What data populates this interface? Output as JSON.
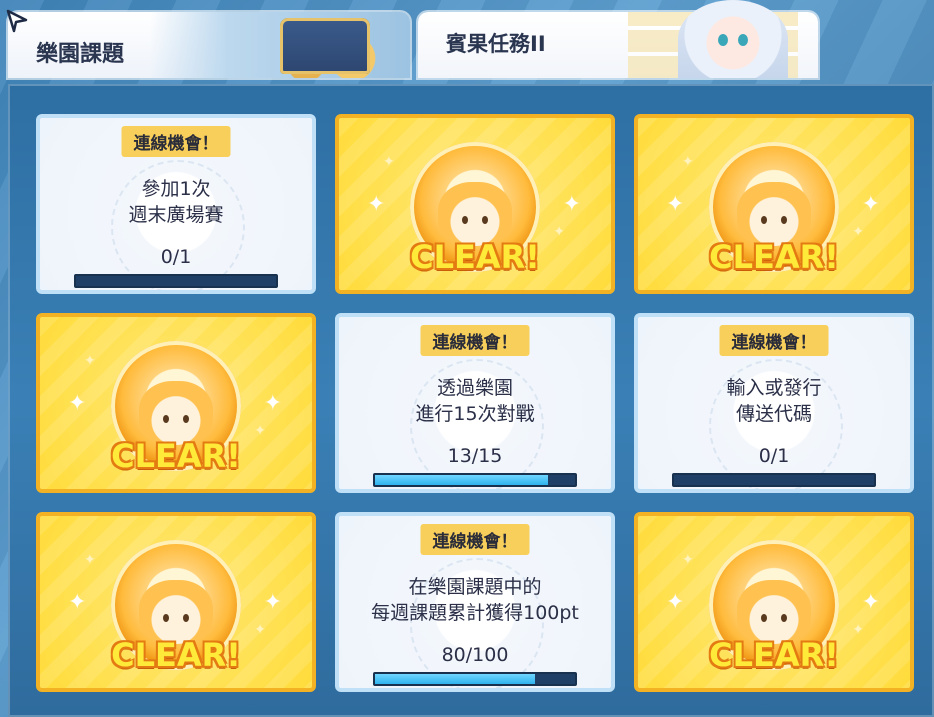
{
  "header": {
    "back_icon": "back-arrow-icon",
    "tab_active_label": "樂園課題",
    "tab_inactive_label": "賓果任務II"
  },
  "colors": {
    "card_clear_bg": "#ffdc3b",
    "card_clear_border": "#f2b224",
    "chance_badge": "#f7cf5a",
    "progress_fill": "#2fb3ee",
    "progress_track": "#1f3f66"
  },
  "grid": {
    "cards": [
      {
        "type": "task",
        "badge": "連線機會！",
        "line1": "參加1次",
        "line2": "週末廣場賽",
        "progress_text": "0/1",
        "progress": 0
      },
      {
        "type": "clear",
        "clear_label": "CLEAR!"
      },
      {
        "type": "clear",
        "clear_label": "CLEAR!"
      },
      {
        "type": "clear",
        "clear_label": "CLEAR!"
      },
      {
        "type": "task",
        "badge": "連線機會！",
        "line1": "透過樂園",
        "line2": "進行15次對戰",
        "progress_text": "13/15",
        "progress": 0.867
      },
      {
        "type": "task",
        "badge": "連線機會！",
        "line1": "輸入或發行",
        "line2": "傳送代碼",
        "progress_text": "0/1",
        "progress": 0
      },
      {
        "type": "clear",
        "clear_label": "CLEAR!"
      },
      {
        "type": "task",
        "badge": "連線機會！",
        "line1": "在樂園課題中的",
        "line2": "每週課題累計獲得100pt",
        "progress_text": "80/100",
        "progress": 0.8
      },
      {
        "type": "clear",
        "clear_label": "CLEAR!"
      }
    ]
  }
}
